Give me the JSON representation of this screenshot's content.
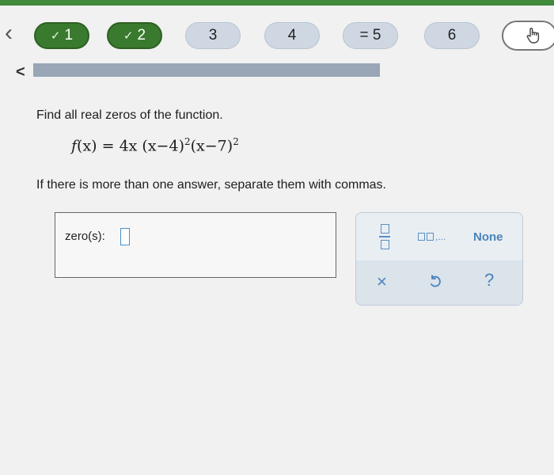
{
  "nav": {
    "back_icon": "chevron-left-icon",
    "steps": [
      {
        "label": "1",
        "status": "done",
        "check": "✓"
      },
      {
        "label": "2",
        "status": "done",
        "check": "✓"
      },
      {
        "label": "3",
        "status": "pending"
      },
      {
        "label": "4",
        "status": "pending"
      },
      {
        "label": "= 5",
        "status": "pending"
      },
      {
        "label": "6",
        "status": "pending"
      }
    ],
    "tool_icon": "pointer-hand-icon"
  },
  "progress": {
    "value": 1.0,
    "back_icon": "chevron-left-icon",
    "back_label": "<"
  },
  "problem": {
    "question": "Find all real zeros of the function.",
    "formula": {
      "fn": "f",
      "lhs": "(x) = 4x (x−4)",
      "exp1": "2",
      "mid": "(x−7)",
      "exp2": "2"
    },
    "instruction": "If there is more than one answer, separate them with commas."
  },
  "answer": {
    "label": "zero(s):",
    "value": ""
  },
  "keypad": {
    "fraction_icon": "fraction-icon",
    "list_label": ",...",
    "none_label": "None",
    "clear_label": "×",
    "undo_icon": "undo-icon",
    "help_label": "?"
  },
  "colors": {
    "success": "#3a7a2e",
    "accent": "#4a83bb",
    "pending": "#cfd8e2"
  }
}
